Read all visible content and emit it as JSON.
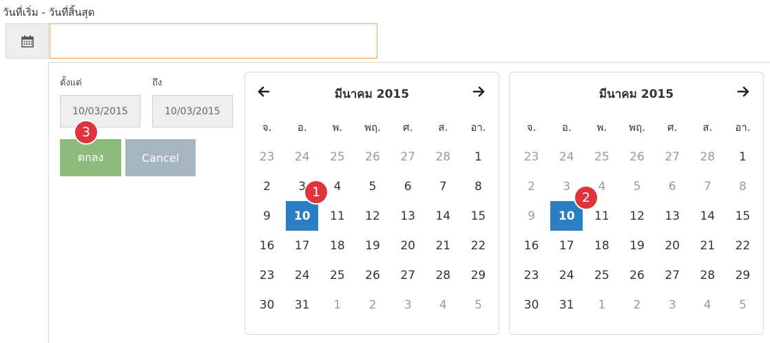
{
  "field": {
    "label": "วันที่เริ่ม - วันที่สิ้นสุด",
    "value": "",
    "icon": "calendar-icon"
  },
  "range": {
    "from_label": "ตั้งแต่",
    "to_label": "ถึง",
    "from_value": "10/03/2015",
    "to_value": "10/03/2015"
  },
  "buttons": {
    "ok_label": "ตกลง",
    "cancel_label": "Cancel"
  },
  "badges": [
    "1",
    "2",
    "3"
  ],
  "colors": {
    "focus_border": "#f0a445",
    "selected_day": "#2a7ec4",
    "ok_button": "#8dbb7c",
    "cancel_button": "#a6b6c0",
    "badge": "#e0343c"
  },
  "calendars": [
    {
      "title": "มีนาคม 2015",
      "weekdays": [
        "จ.",
        "อ.",
        "พ.",
        "พฤ.",
        "ศ.",
        "ส.",
        "อา."
      ],
      "weeks": [
        [
          "23",
          "24",
          "25",
          "26",
          "27",
          "28",
          "1"
        ],
        [
          "2",
          "3",
          "4",
          "5",
          "6",
          "7",
          "8"
        ],
        [
          "9",
          "10",
          "11",
          "12",
          "13",
          "14",
          "15"
        ],
        [
          "16",
          "17",
          "18",
          "19",
          "20",
          "21",
          "22"
        ],
        [
          "23",
          "24",
          "25",
          "26",
          "27",
          "28",
          "29"
        ],
        [
          "30",
          "31",
          "1",
          "2",
          "3",
          "4",
          "5"
        ]
      ],
      "selected": "10"
    },
    {
      "title": "มีนาคม 2015",
      "weekdays": [
        "จ.",
        "อ.",
        "พ.",
        "พฤ.",
        "ศ.",
        "ส.",
        "อา."
      ],
      "weeks": [
        [
          "23",
          "24",
          "25",
          "26",
          "27",
          "28",
          "1"
        ],
        [
          "2",
          "3",
          "4",
          "5",
          "6",
          "7",
          "8"
        ],
        [
          "9",
          "10",
          "11",
          "12",
          "13",
          "14",
          "15"
        ],
        [
          "16",
          "17",
          "18",
          "19",
          "20",
          "21",
          "22"
        ],
        [
          "23",
          "24",
          "25",
          "26",
          "27",
          "28",
          "29"
        ],
        [
          "30",
          "31",
          "1",
          "2",
          "3",
          "4",
          "5"
        ]
      ],
      "selected": "10"
    }
  ]
}
